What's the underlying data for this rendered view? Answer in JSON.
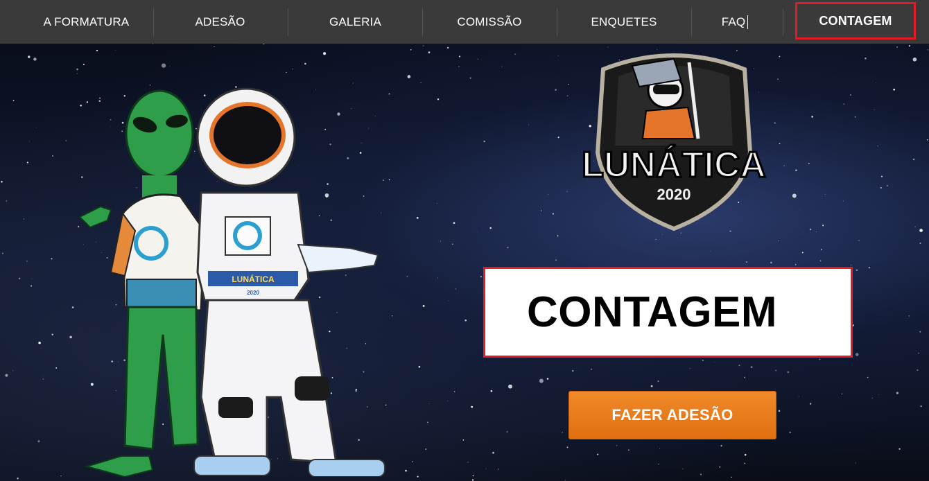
{
  "nav": {
    "items": [
      {
        "label": "A FORMATURA"
      },
      {
        "label": "ADESÃO"
      },
      {
        "label": "GALERIA"
      },
      {
        "label": "COMISSÃO"
      },
      {
        "label": "ENQUETES"
      },
      {
        "label": "FAQ"
      },
      {
        "label": "CONTAGEM"
      }
    ]
  },
  "logo": {
    "name": "LUNÁTICA",
    "year": "2020"
  },
  "mascot_badge": {
    "name": "LUNÁTICA",
    "year": "2020"
  },
  "count_box": {
    "text": "CONTAGEM"
  },
  "cta": {
    "label": "FAZER ADESÃO"
  },
  "colors": {
    "nav_bg": "#3a3a3a",
    "highlight": "#e01c24",
    "cta": "#e8781a"
  }
}
